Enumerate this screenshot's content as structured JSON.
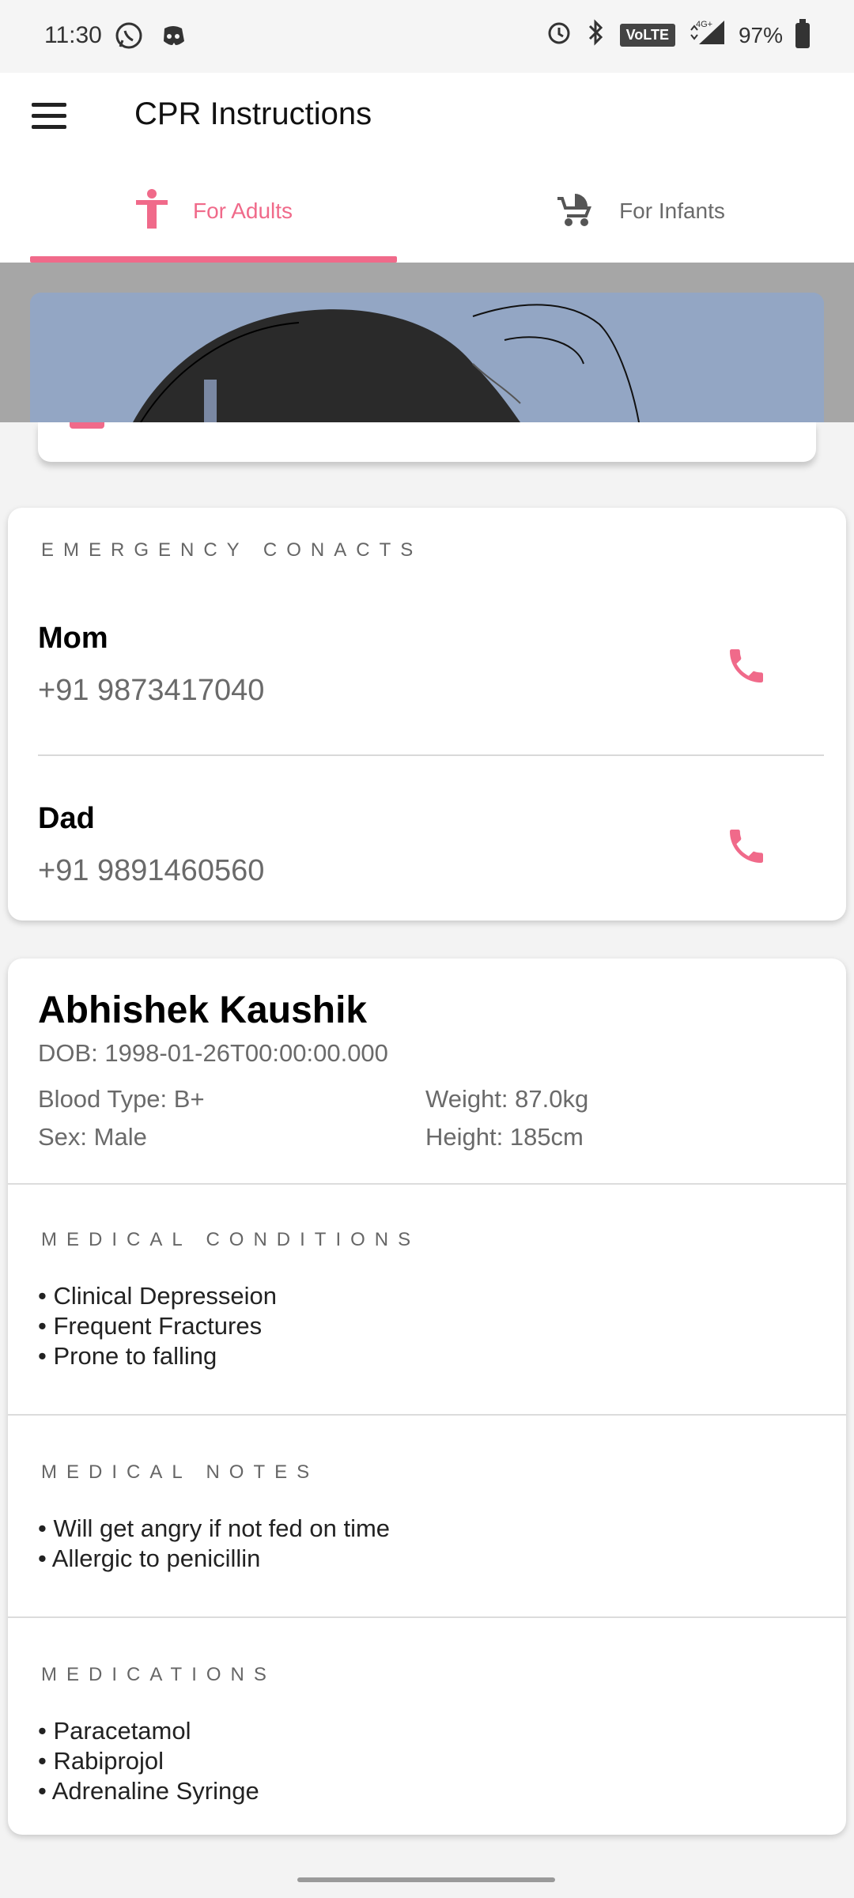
{
  "status_bar": {
    "time": "11:30",
    "left_icons": [
      "whatsapp-icon",
      "discord-icon"
    ],
    "right_icons": [
      "alarm-icon",
      "bluetooth-icon",
      "volte-icon",
      "signal-4g-icon",
      "battery-icon"
    ],
    "volte_label": "VoLTE",
    "network_label": "4G+",
    "battery": "97%"
  },
  "app_bar": {
    "title": "CPR Instructions"
  },
  "tabs": [
    {
      "label": "For Adults",
      "icon": "accessibility-icon",
      "active": true
    },
    {
      "label": "For Infants",
      "icon": "stroller-icon",
      "active": false
    }
  ],
  "emergency_contacts": {
    "title": "EMERGENCY CONACTS",
    "contacts": [
      {
        "name": "Mom",
        "phone": "+91 9873417040"
      },
      {
        "name": "Dad",
        "phone": "+91 9891460560"
      }
    ]
  },
  "profile": {
    "name": "Abhishek Kaushik",
    "dob": "DOB: 1998-01-26T00:00:00.000",
    "blood_type": "Blood Type: B+",
    "weight": "Weight: 87.0kg",
    "sex": "Sex: Male",
    "height": "Height: 185cm",
    "medical_conditions": {
      "title": "MEDICAL CONDITIONS",
      "items": [
        "• Clinical Depresseion",
        "• Frequent Fractures",
        "• Prone to falling"
      ]
    },
    "medical_notes": {
      "title": "MEDICAL NOTES",
      "items": [
        "• Will get angry if not fed on time",
        "• Allergic to penicillin"
      ]
    },
    "medications": {
      "title": "MEDICATIONS",
      "items": [
        "• Paracetamol",
        "• Rabiprojol",
        "• Adrenaline Syringe"
      ]
    }
  },
  "colors": {
    "accent": "#f06a8a",
    "muted_text": "#6a6a6a",
    "card_bg": "#ffffff",
    "page_bg": "#f3f3f3",
    "scrim": "#a6a6a6"
  }
}
